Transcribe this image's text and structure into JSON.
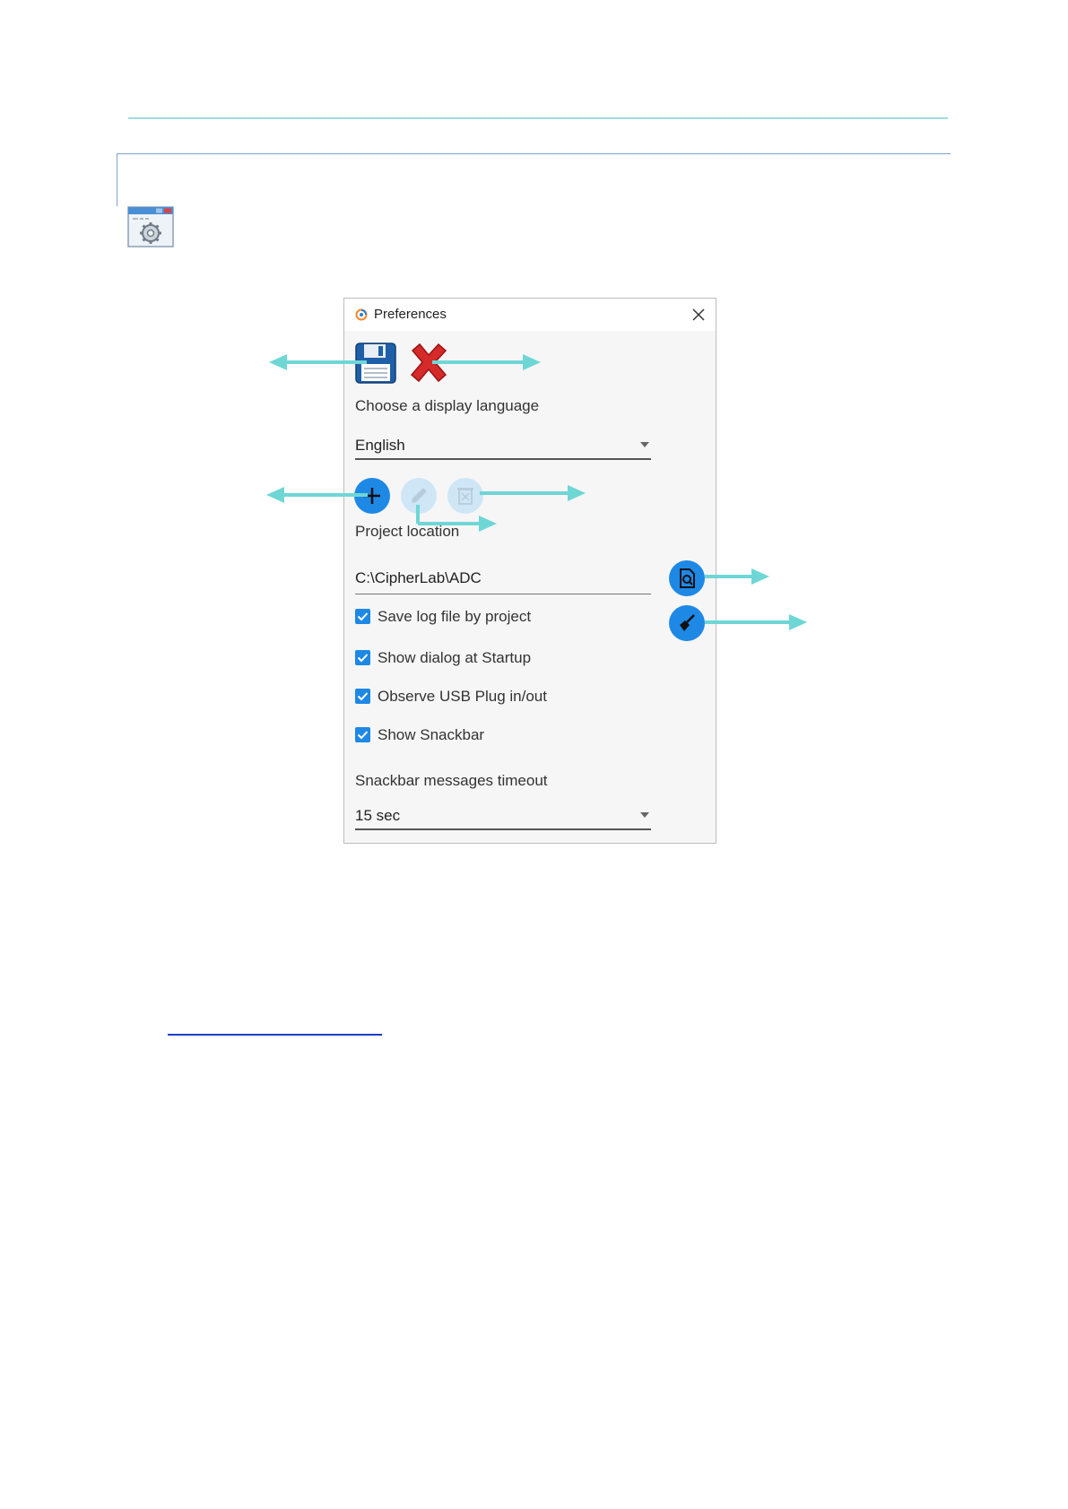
{
  "dialog": {
    "title": "Preferences",
    "language_label": "Choose a display language",
    "language_value": "English",
    "project_label": "Project location",
    "project_path": "C:\\CipherLab\\ADC",
    "checkboxes": [
      {
        "label": "Save log file by project",
        "checked": true
      },
      {
        "label": "Show dialog at Startup",
        "checked": true
      },
      {
        "label": "Observe USB Plug in/out",
        "checked": true
      },
      {
        "label": "Show Snackbar",
        "checked": true
      }
    ],
    "timeout_label": "Snackbar messages timeout",
    "timeout_value": "15 sec"
  },
  "icons": {
    "settings_app": "settings-window-icon",
    "save": "floppy-disk-icon",
    "cancel": "red-x-icon",
    "add": "plus-icon",
    "edit": "pencil-icon",
    "delete": "trash-icon",
    "browse": "folder-search-icon",
    "clean": "broom-icon",
    "close": "close-icon"
  },
  "colors": {
    "accent": "#1e88e5",
    "arrow": "#6fd6d6",
    "disabled": "#cfe6f7"
  }
}
